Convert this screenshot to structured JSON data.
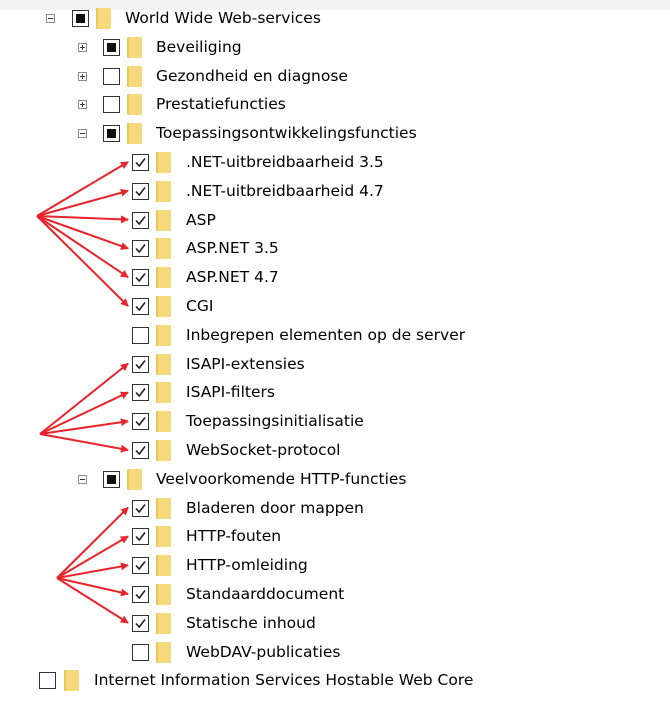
{
  "tree": [
    {
      "label": "World Wide Web-services",
      "expander": "minus",
      "check": "partial"
    },
    {
      "label": "Beveiliging",
      "expander": "plus",
      "check": "partial"
    },
    {
      "label": "Gezondheid en diagnose",
      "expander": "plus",
      "check": "unchecked"
    },
    {
      "label": "Prestatiefuncties",
      "expander": "plus",
      "check": "unchecked"
    },
    {
      "label": "Toepassingsontwikkelingsfuncties",
      "expander": "minus",
      "check": "partial"
    },
    {
      "label": ".NET-uitbreidbaarheid 3.5",
      "expander": "none",
      "check": "checked"
    },
    {
      "label": ".NET-uitbreidbaarheid 4.7",
      "expander": "none",
      "check": "checked"
    },
    {
      "label": "ASP",
      "expander": "none",
      "check": "checked"
    },
    {
      "label": "ASP.NET 3.5",
      "expander": "none",
      "check": "checked"
    },
    {
      "label": "ASP.NET 4.7",
      "expander": "none",
      "check": "checked"
    },
    {
      "label": "CGI",
      "expander": "none",
      "check": "checked"
    },
    {
      "label": "Inbegrepen elementen op de server",
      "expander": "none",
      "check": "unchecked"
    },
    {
      "label": "ISAPI-extensies",
      "expander": "none",
      "check": "checked"
    },
    {
      "label": "ISAPI-filters",
      "expander": "none",
      "check": "checked"
    },
    {
      "label": "Toepassingsinitialisatie",
      "expander": "none",
      "check": "checked"
    },
    {
      "label": "WebSocket-protocol",
      "expander": "none",
      "check": "checked"
    },
    {
      "label": "Veelvoorkomende HTTP-functies",
      "expander": "minus",
      "check": "partial"
    },
    {
      "label": "Bladeren door mappen",
      "expander": "none",
      "check": "checked"
    },
    {
      "label": "HTTP-fouten",
      "expander": "none",
      "check": "checked"
    },
    {
      "label": "HTTP-omleiding",
      "expander": "none",
      "check": "checked"
    },
    {
      "label": "Standaarddocument",
      "expander": "none",
      "check": "checked"
    },
    {
      "label": "Statische inhoud",
      "expander": "none",
      "check": "checked"
    },
    {
      "label": "WebDAV-publicaties",
      "expander": "none",
      "check": "unchecked"
    },
    {
      "label": "Internet Information Services Hostable Web Core",
      "expander": "none",
      "check": "unchecked"
    }
  ],
  "colors": {
    "arrow": "#e8232a",
    "folder": "#f6d97d",
    "check_border": "#333333"
  }
}
